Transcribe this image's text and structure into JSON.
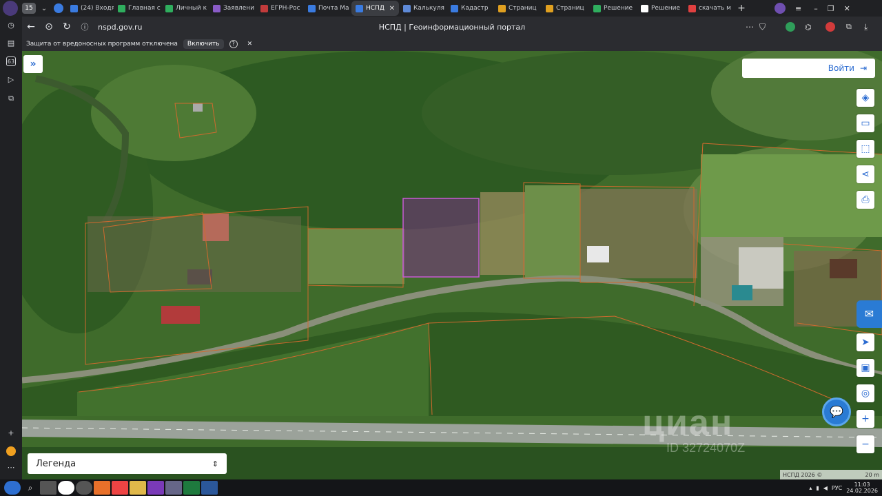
{
  "browser": {
    "tab_count": "15",
    "tabs": [
      {
        "label": "(24) Входя",
        "color": "#3a7be0"
      },
      {
        "label": "Главная с",
        "color": "#2fae5e"
      },
      {
        "label": "Личный к",
        "color": "#2fae5e"
      },
      {
        "label": "Заявлени",
        "color": "#8a5cc7"
      },
      {
        "label": "ЕГРН-Рос",
        "color": "#c23b3b"
      },
      {
        "label": "Почта Ма",
        "color": "#3a7be0"
      },
      {
        "label": "НСПД",
        "color": "#3a7be0"
      },
      {
        "label": "Калькуля",
        "color": "#5e8ad8"
      },
      {
        "label": "Кадастр",
        "color": "#3a7be0"
      },
      {
        "label": "Страниц",
        "color": "#e0a020"
      },
      {
        "label": "Страниц",
        "color": "#e0a020"
      },
      {
        "label": "Решение",
        "color": "#2fae5e"
      },
      {
        "label": "Решение",
        "color": "#ffffff"
      },
      {
        "label": "скачать м",
        "color": "#e04040"
      }
    ],
    "url": "nspd.gov.ru",
    "page_title": "НСПД | Геоинформационный портал",
    "protection_text": "Защита от вредоносных программ отключена",
    "enable_label": "Включить",
    "sidebar_badge": "63"
  },
  "map": {
    "login_label": "Войти",
    "legend_label": "Легенда",
    "watermark": "циан",
    "watermark_id": "ID 32724070Z",
    "copyright": "НСПД 2026 ©",
    "scale_label": "20 m",
    "tools": [
      "layers-icon",
      "ruler-icon",
      "select-area-icon",
      "share-icon",
      "print-icon",
      "locate-icon",
      "minimap-icon",
      "pin-search-icon",
      "zoom-in-icon",
      "zoom-out-icon"
    ]
  },
  "taskbar": {
    "language": "РУС",
    "time": "11:03",
    "date": "24.02.2026"
  }
}
